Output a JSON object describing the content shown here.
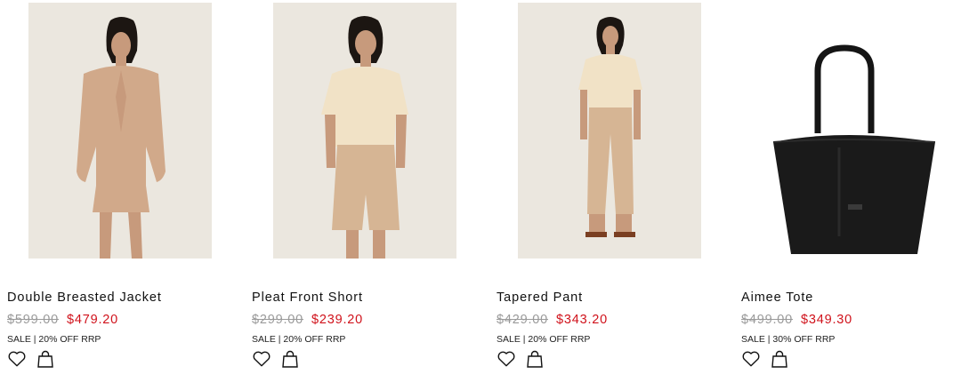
{
  "products": [
    {
      "name": "Double Breasted Jacket",
      "old_price": "$599.00",
      "new_price": "$479.20",
      "sale": "SALE | 20% OFF RRP",
      "image": "model-double-breasted-jacket"
    },
    {
      "name": "Pleat Front Short",
      "old_price": "$299.00",
      "new_price": "$239.20",
      "sale": "SALE | 20% OFF RRP",
      "image": "model-pleat-front-short"
    },
    {
      "name": "Tapered Pant",
      "old_price": "$429.00",
      "new_price": "$343.20",
      "sale": "SALE | 20% OFF RRP",
      "image": "model-tapered-pant"
    },
    {
      "name": "Aimee Tote",
      "old_price": "$499.00",
      "new_price": "$349.30",
      "sale": "SALE | 30% OFF RRP",
      "image": "black-leather-tote-bag"
    }
  ],
  "icons": {
    "wishlist": "heart-icon",
    "add_to_bag": "shopping-bag-icon"
  },
  "colors": {
    "sale_price": "#d0121b",
    "old_price": "#9a9a9a",
    "text": "#111111",
    "image_bg": "#ebe7df"
  }
}
